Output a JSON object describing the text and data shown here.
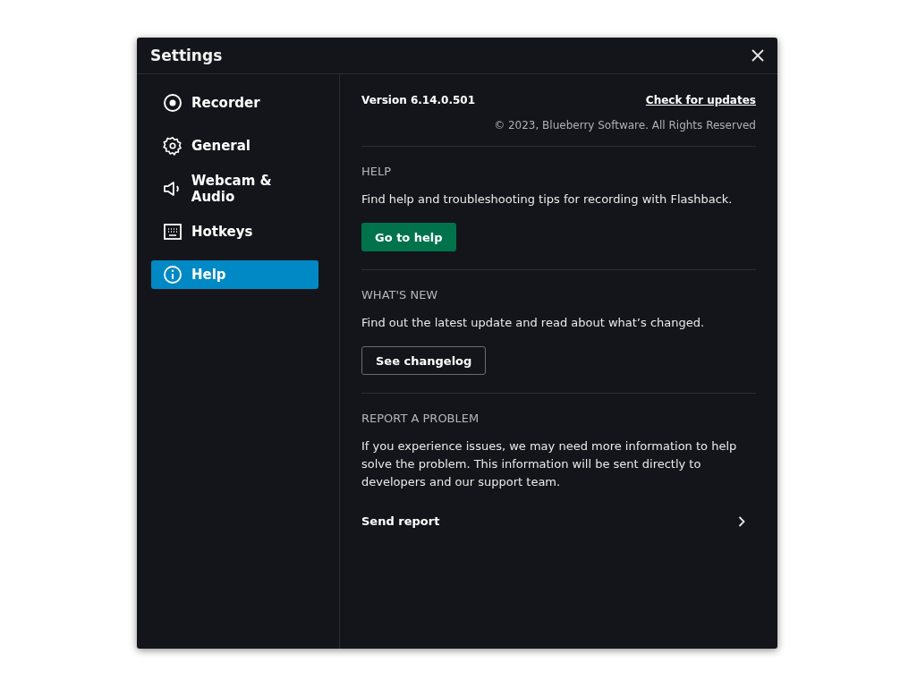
{
  "window": {
    "title": "Settings"
  },
  "sidebar": {
    "items": [
      {
        "label": "Recorder",
        "selected": false
      },
      {
        "label": "General",
        "selected": false
      },
      {
        "label": "Webcam & Audio",
        "selected": false
      },
      {
        "label": "Hotkeys",
        "selected": false
      },
      {
        "label": "Help",
        "selected": true
      }
    ]
  },
  "about": {
    "version": "Version 6.14.0.501",
    "update_link": "Check for updates",
    "copyright": "© 2023, Blueberry Software. All Rights Reserved"
  },
  "sections": [
    {
      "heading": "HELP",
      "text": "Find help and troubleshooting tips for recording with Flashback.",
      "action": {
        "kind": "primary",
        "label": "Go to help"
      }
    },
    {
      "heading": "WHAT'S NEW",
      "text": "Find out the latest update and read about what’s changed.",
      "action": {
        "kind": "outline",
        "label": "See changelog"
      }
    },
    {
      "heading": "REPORT A PROBLEM",
      "text": "If you experience issues, we may need more information to help solve the problem. This information will be sent directly to developers and our support team.",
      "action": {
        "kind": "row",
        "label": "Send report"
      }
    }
  ]
}
